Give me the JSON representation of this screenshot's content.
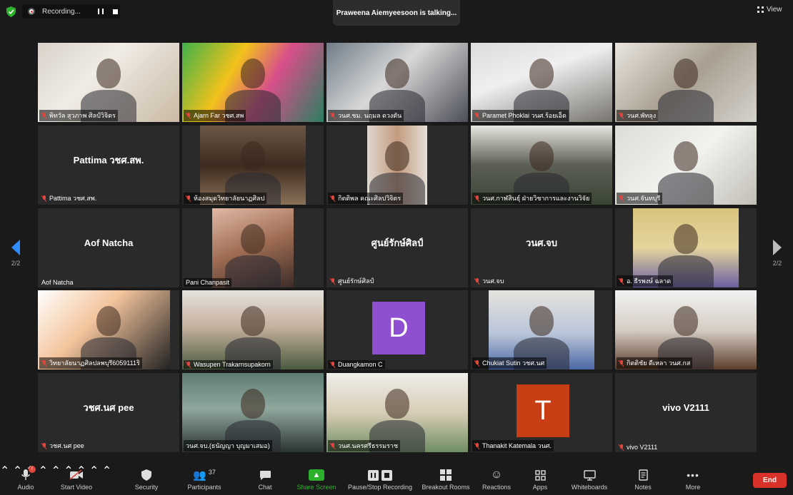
{
  "recording": {
    "label": "Recording..."
  },
  "active_speaker": "Praweena Aiemyeesoon is talking...",
  "view_label": "View",
  "page_indicator": {
    "left": "2/2",
    "right": "2/2"
  },
  "tiles": [
    {
      "name": "พิทวัล สุวภาพ ศิลป์วิจิตร",
      "muted": true,
      "video": true
    },
    {
      "name": "Ajarn Far วชศ.สพ",
      "muted": true,
      "video": true
    },
    {
      "name": "วนศ.ชม. นฤมล ดวงตัน",
      "muted": true,
      "video": true
    },
    {
      "name": "Paramet Phoklai วนศ.ร้อยเอ็ด",
      "muted": true,
      "video": true
    },
    {
      "name": "วนศ.พัทลุง",
      "muted": true,
      "video": true
    },
    {
      "name": "Pattima วชศ.สพ.",
      "display_name": "Pattima วชศ.สพ.",
      "muted": true,
      "video": false
    },
    {
      "name": "ห้องสมุดวิทยาลัยนาฏศิลป",
      "muted": true,
      "video": true
    },
    {
      "name": "กิตติพล คณะศิลปวิจิตร",
      "muted": true,
      "video": true
    },
    {
      "name": "วนศ.กาฬสินธุ์ ฝ่ายวิชาการและงานวิจัย",
      "muted": true,
      "video": true
    },
    {
      "name": "วนศ.จันทบุรี",
      "muted": true,
      "video": true
    },
    {
      "name": "Aof Natcha",
      "display_name": "Aof Natcha",
      "muted": false,
      "video": false
    },
    {
      "name": "Pani Chanpasit",
      "muted": false,
      "video": true
    },
    {
      "name": "ศูนย์รักษ์ศิลป์",
      "display_name": "ศูนย์รักษ์ศิลป์",
      "muted": true,
      "video": false
    },
    {
      "name": "วนศ.จบ",
      "display_name": "วนศ.จบ",
      "muted": true,
      "video": false
    },
    {
      "name": "อ. ธีรพงษ์ ฉลาด",
      "muted": true,
      "video": true
    },
    {
      "name": "วิทยาลัยนาฏศิลปลพบุรี6059111ริ",
      "muted": true,
      "video": true
    },
    {
      "name": "Wasupen Trakarnsupakorn",
      "muted": true,
      "video": true
    },
    {
      "name": "Duangkamon C",
      "avatar_letter": "D",
      "avatar_color": "#8f4fd1",
      "muted": true,
      "video": false
    },
    {
      "name": "Chukiat Sutin วชศ.นศ",
      "muted": true,
      "video": true
    },
    {
      "name": "กิตติชัย ดีเหลา วนศ.กส",
      "muted": true,
      "video": true
    },
    {
      "name": "วชศ.นศ pee",
      "display_name": "วชศ.นศ pee",
      "muted": true,
      "video": false
    },
    {
      "name": "วนศ.จบ.(ธนัญญา บุญมาเสมอ)",
      "muted": false,
      "video": true
    },
    {
      "name": "วนศ.นครศรีธรรมราช",
      "muted": true,
      "video": true
    },
    {
      "name": "Thanakit Katemala วนศ.",
      "avatar_letter": "T",
      "avatar_color": "#c73d14",
      "muted": true,
      "video": false
    },
    {
      "name": "vivo V2111",
      "display_name": "vivo V2111",
      "muted": true,
      "video": false
    }
  ],
  "toolbar": {
    "audio": "Audio",
    "audio_badge": "!",
    "start_video": "Start Video",
    "security": "Security",
    "participants": "Participants",
    "participants_count": "37",
    "chat": "Chat",
    "share_screen": "Share Screen",
    "recording": "Pause/Stop Recording",
    "breakout": "Breakout Rooms",
    "reactions": "Reactions",
    "apps": "Apps",
    "whiteboards": "Whiteboards",
    "notes": "Notes",
    "more": "More",
    "end": "End"
  },
  "colors": {
    "share_green": "#2db12d",
    "end_red": "#d9322b",
    "accent_blue": "#2d8cff",
    "muted_red": "#e0463d"
  }
}
